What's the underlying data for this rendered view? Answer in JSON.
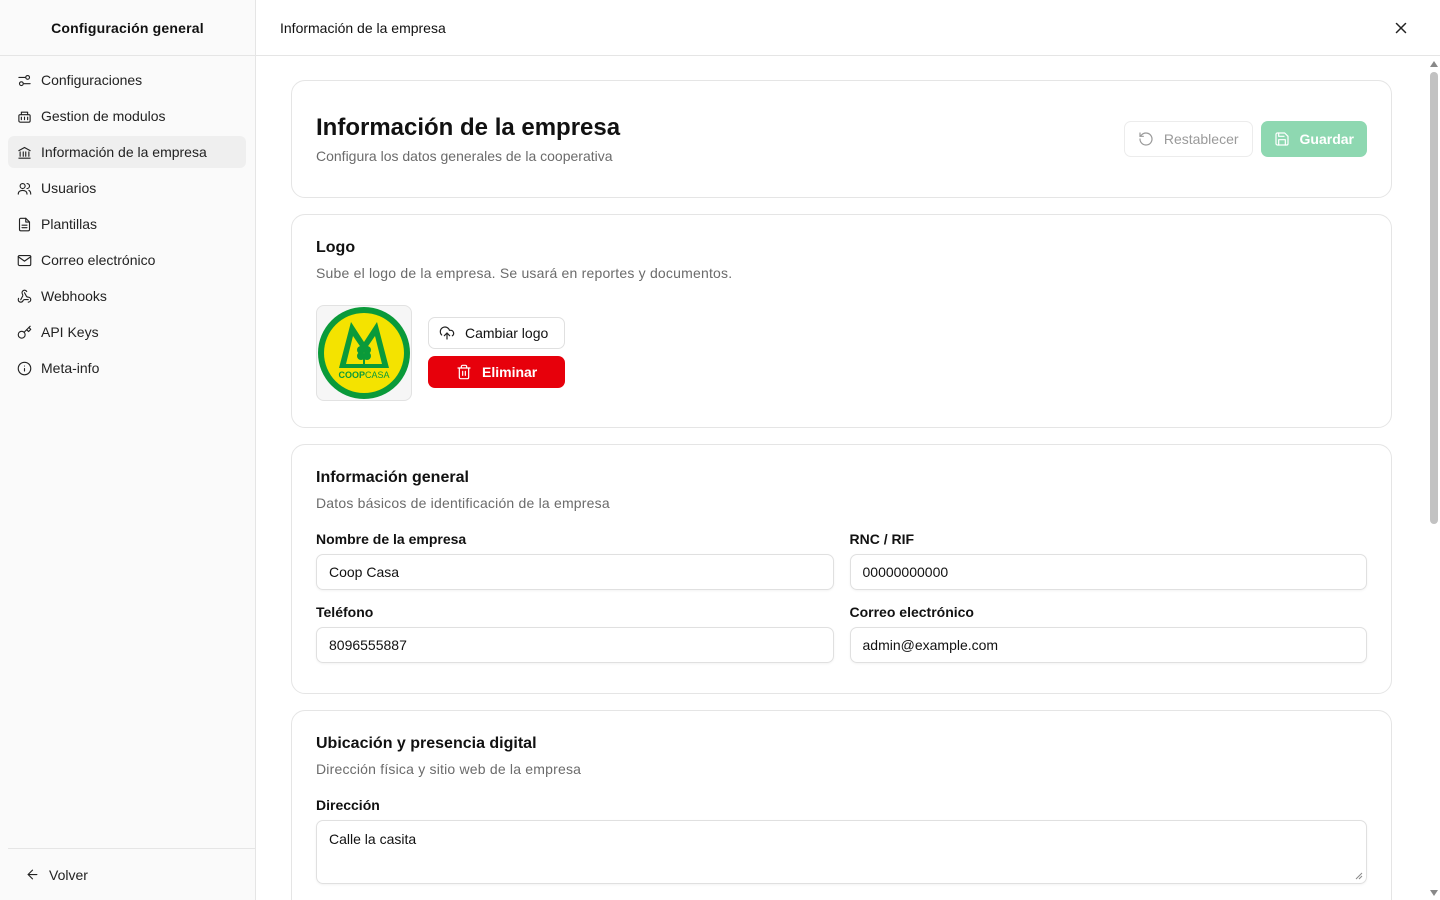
{
  "sidebar": {
    "title": "Configuración general",
    "items": [
      {
        "label": "Configuraciones",
        "icon": "sliders-icon"
      },
      {
        "label": "Gestion de modulos",
        "icon": "modules-icon"
      },
      {
        "label": "Información de la empresa",
        "icon": "bank-icon",
        "active": true
      },
      {
        "label": "Usuarios",
        "icon": "users-icon"
      },
      {
        "label": "Plantillas",
        "icon": "file-text-icon"
      },
      {
        "label": "Correo electrónico",
        "icon": "mail-icon"
      },
      {
        "label": "Webhooks",
        "icon": "webhook-icon"
      },
      {
        "label": "API Keys",
        "icon": "key-icon"
      },
      {
        "label": "Meta-info",
        "icon": "info-icon"
      }
    ],
    "back_label": "Volver"
  },
  "topbar": {
    "title": "Información de la empresa"
  },
  "header": {
    "title": "Información de la empresa",
    "subtitle": "Configura los datos generales de la cooperativa",
    "reset_label": "Restablecer",
    "save_label": "Guardar"
  },
  "logo_section": {
    "title": "Logo",
    "subtitle": "Sube el logo de la empresa. Se usará en reportes y documentos.",
    "change_label": "Cambiar logo",
    "delete_label": "Eliminar",
    "logo_text_1": "COOP",
    "logo_text_2": "CASA"
  },
  "general_section": {
    "title": "Información general",
    "subtitle": "Datos básicos de identificación de la empresa",
    "fields": {
      "name": {
        "label": "Nombre de la empresa",
        "value": "Coop Casa"
      },
      "rnc": {
        "label": "RNC / RIF",
        "value": "00000000000"
      },
      "phone": {
        "label": "Teléfono",
        "value": "8096555887"
      },
      "email": {
        "label": "Correo electrónico",
        "value": "admin@example.com"
      }
    }
  },
  "location_section": {
    "title": "Ubicación y presencia digital",
    "subtitle": "Dirección física y sitio web de la empresa",
    "address": {
      "label": "Dirección",
      "value": "Calle la casita"
    }
  },
  "colors": {
    "danger": "#e7000b",
    "primary_disabled": "#8ed8b1",
    "logo_green": "#0a9a3a",
    "logo_yellow": "#f4e300"
  }
}
